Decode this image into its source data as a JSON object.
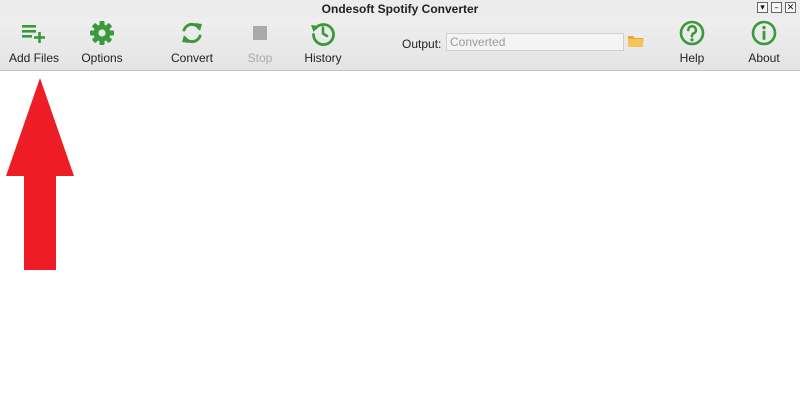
{
  "window": {
    "title": "Ondesoft Spotify Converter",
    "controls": {
      "menu": "▾",
      "minimize": "–",
      "close": "✕"
    }
  },
  "toolbar": {
    "add_files": {
      "label": "Add Files",
      "icon": "add-list-icon"
    },
    "options": {
      "label": "Options",
      "icon": "gear-icon"
    },
    "convert": {
      "label": "Convert",
      "icon": "refresh-icon"
    },
    "stop": {
      "label": "Stop",
      "icon": "stop-square-icon",
      "enabled": false
    },
    "history": {
      "label": "History",
      "icon": "history-clock-icon"
    },
    "help": {
      "label": "Help",
      "icon": "question-circle-icon"
    },
    "about": {
      "label": "About",
      "icon": "info-circle-icon"
    }
  },
  "output": {
    "label": "Output:",
    "value": "Converted",
    "folder_icon": "folder-icon"
  },
  "colors": {
    "accent_green": "#3a9a3a",
    "disabled_gray": "#aaaaaa",
    "annotation_red": "#ee1c24"
  },
  "annotation": {
    "type": "arrow",
    "color": "#ee1c24",
    "points_to": "Add Files"
  }
}
